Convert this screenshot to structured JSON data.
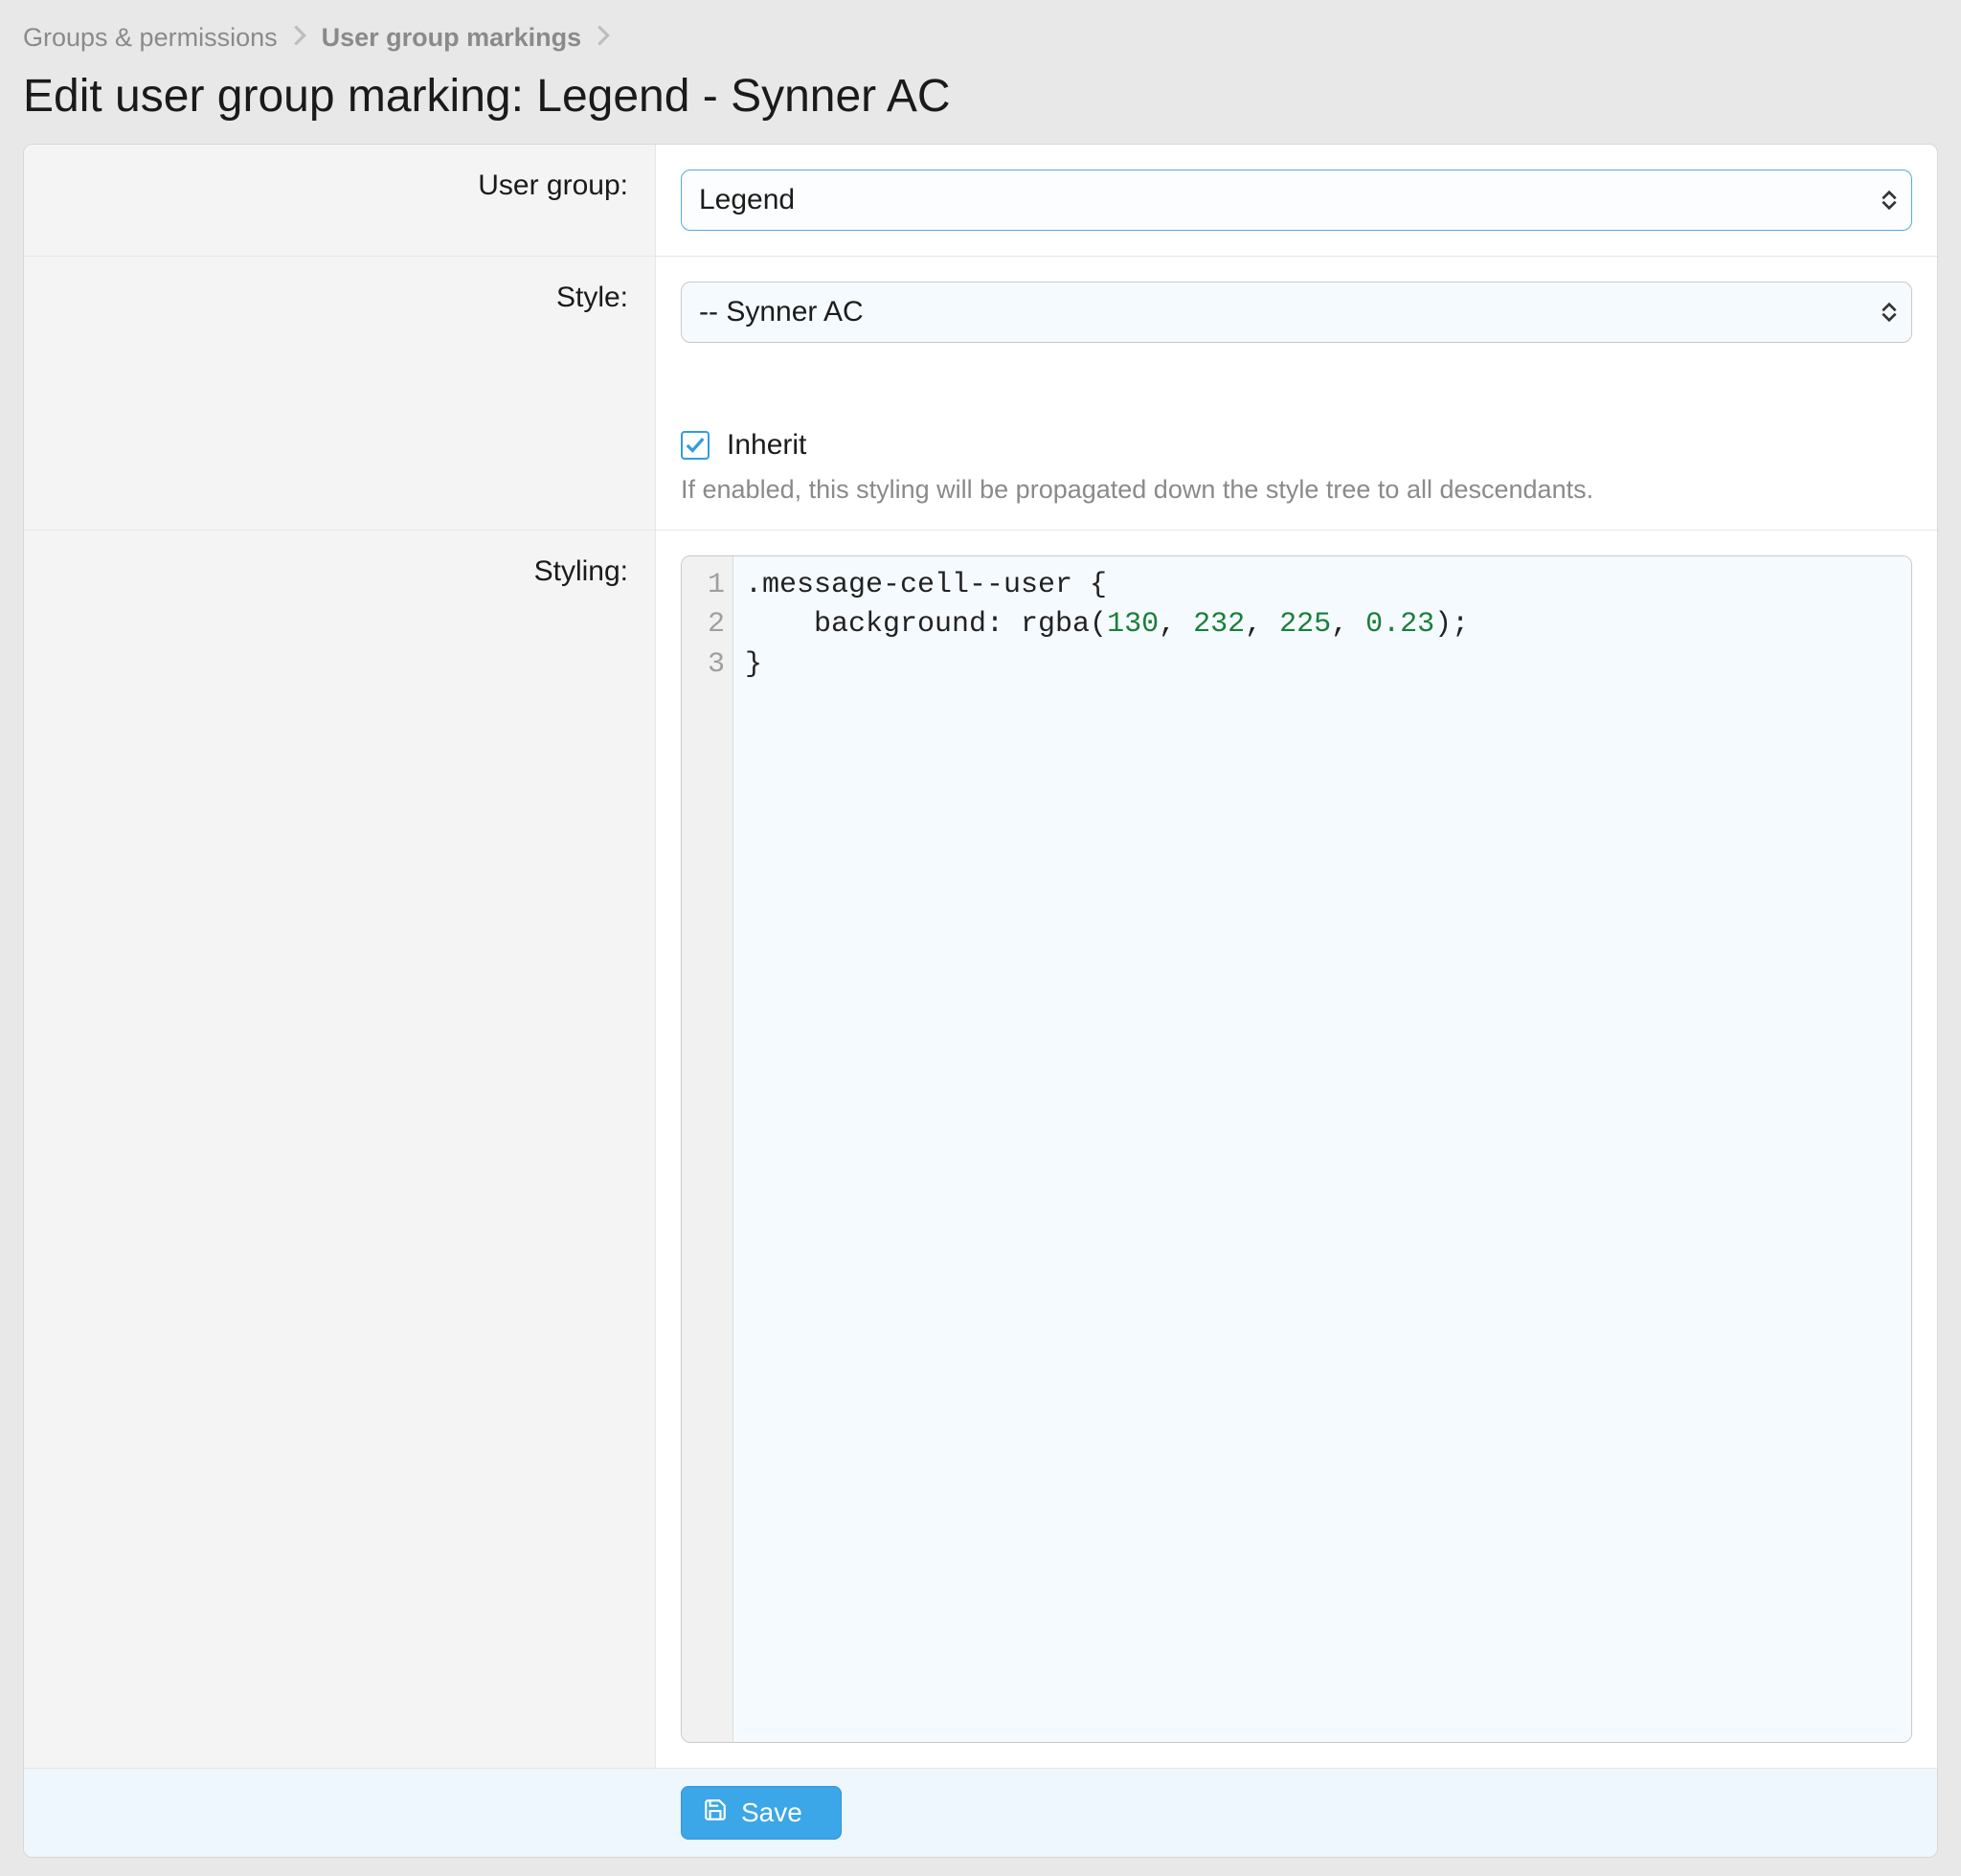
{
  "breadcrumb": {
    "items": [
      {
        "label": "Groups & permissions"
      },
      {
        "label": "User group markings",
        "current": true
      }
    ]
  },
  "page": {
    "title": "Edit user group marking: Legend - Synner AC"
  },
  "form": {
    "user_group": {
      "label": "User group:",
      "value": "Legend"
    },
    "style": {
      "label": "Style:",
      "value": "-- Synner AC",
      "inherit_checked": true,
      "inherit_label": "Inherit",
      "inherit_help": "If enabled, this styling will be propagated down the style tree to all descendants."
    },
    "styling": {
      "label": "Styling:",
      "code": {
        "lines": [
          "1",
          "2",
          "3"
        ],
        "raw": ".message-cell--user {\n    background: rgba(130, 232, 225, 0.23);\n}",
        "l1_a": ".message-cell--user {",
        "l2_a": "    background: rgba(",
        "l2_n1": "130",
        "l2_s1": ", ",
        "l2_n2": "232",
        "l2_s2": ", ",
        "l2_n3": "225",
        "l2_s3": ", ",
        "l2_n4": "0.23",
        "l2_b": ");",
        "l3_a": "}"
      }
    },
    "save_label": "Save"
  }
}
